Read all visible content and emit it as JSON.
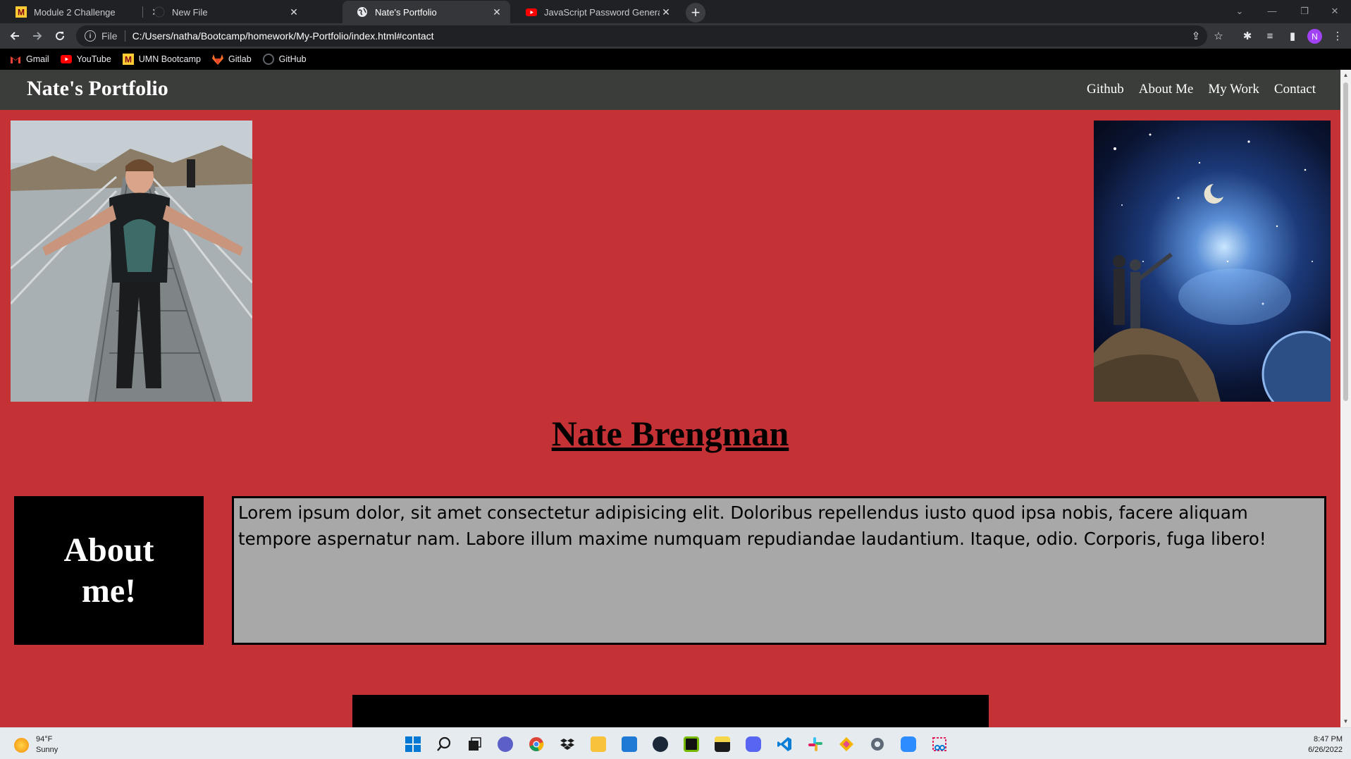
{
  "browser": {
    "tabs": [
      {
        "label": "Module 2 Challenge",
        "favicon": "umn-icon",
        "active": false
      },
      {
        "label": "New File",
        "favicon": "github-icon",
        "active": false
      },
      {
        "label": "Nate's Portfolio",
        "favicon": "globe-icon",
        "active": true
      },
      {
        "label": "JavaScript Password Generator -",
        "favicon": "youtube-icon",
        "active": false
      }
    ],
    "address": {
      "scheme_label": "File",
      "url": "C:/Users/natha/Bootcamp/homework/My-Portfolio/index.html#contact"
    },
    "profile_initial": "N",
    "bookmarks": [
      {
        "label": "Gmail",
        "icon": "gmail-icon"
      },
      {
        "label": "YouTube",
        "icon": "youtube-icon"
      },
      {
        "label": "UMN Bootcamp",
        "icon": "umn-icon"
      },
      {
        "label": "Gitlab",
        "icon": "gitlab-icon"
      },
      {
        "label": "GitHub",
        "icon": "github-icon"
      }
    ]
  },
  "page": {
    "site_title": "Nate's Portfolio",
    "nav": [
      "Github",
      "About Me",
      "My Work",
      "Contact"
    ],
    "name_heading": "Nate Brengman",
    "about": {
      "title": "About me!",
      "text": "Lorem ipsum dolor, sit amet consectetur adipisicing elit. Doloribus repellendus iusto quod ipsa nobis, facere aliquam tempore aspernatur nam. Labore illum maxime numquam repudiandae laudantium. Itaque, odio. Corporis, fuga libero!"
    },
    "colors": {
      "background": "#c43235",
      "header": "#3b3d3a",
      "about_box": "#000000",
      "text_box": "#a8a8a8"
    }
  },
  "taskbar": {
    "weather": {
      "temp": "94°F",
      "condition": "Sunny"
    },
    "time": "8:47 PM",
    "date": "6/26/2022",
    "apps": [
      "start-icon",
      "search-icon",
      "task-view-icon",
      "teams-icon",
      "chrome-icon",
      "dropbox-icon",
      "file-explorer-icon",
      "mail-icon",
      "steam-icon",
      "nvidia-icon",
      "sticky-notes-icon",
      "discord-icon",
      "vscode-icon",
      "slack-icon",
      "git-icon",
      "settings-icon",
      "zoom-icon",
      "snipping-tool-icon"
    ]
  }
}
